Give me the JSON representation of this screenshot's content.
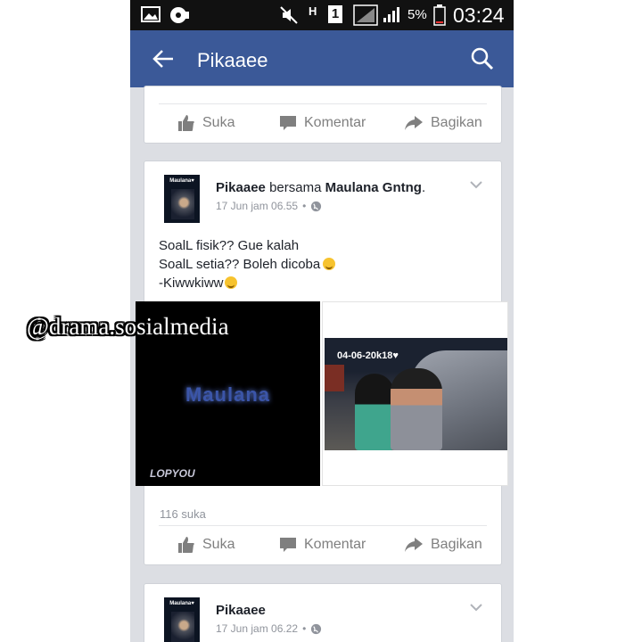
{
  "status_bar": {
    "battery": "5%",
    "time": "03:24",
    "sim_badge": "1",
    "network_badge": "H"
  },
  "app_bar": {
    "title": "Pikaaee"
  },
  "actions": {
    "like": "Suka",
    "comment": "Komentar",
    "share": "Bagikan"
  },
  "posts": [
    {
      "author": "Pikaaee",
      "with_text": "bersama",
      "tagged": "Maulana Gntng",
      "tagged_suffix": ".",
      "timestamp": "17 Jun jam 06.55",
      "avatar_caption": "Maulana♥",
      "lines": [
        "SoalL fisik?? Gue kalah",
        "SoalL setia?? Boleh dicoba",
        "-Kiwwkiww"
      ],
      "photo_left_text": "Maulana",
      "photo_left_signature": "LOPYOU",
      "photo_right_text": "04-06-20k18♥",
      "likes": "116 suka"
    },
    {
      "author": "Pikaaee",
      "timestamp": "17 Jun jam 06.22",
      "avatar_caption": "Maulana♥"
    }
  ],
  "watermark": "@drama.sosialmedia",
  "colors": {
    "brand": "#3b5998",
    "background": "#dcdee3",
    "muted": "#90949c"
  }
}
